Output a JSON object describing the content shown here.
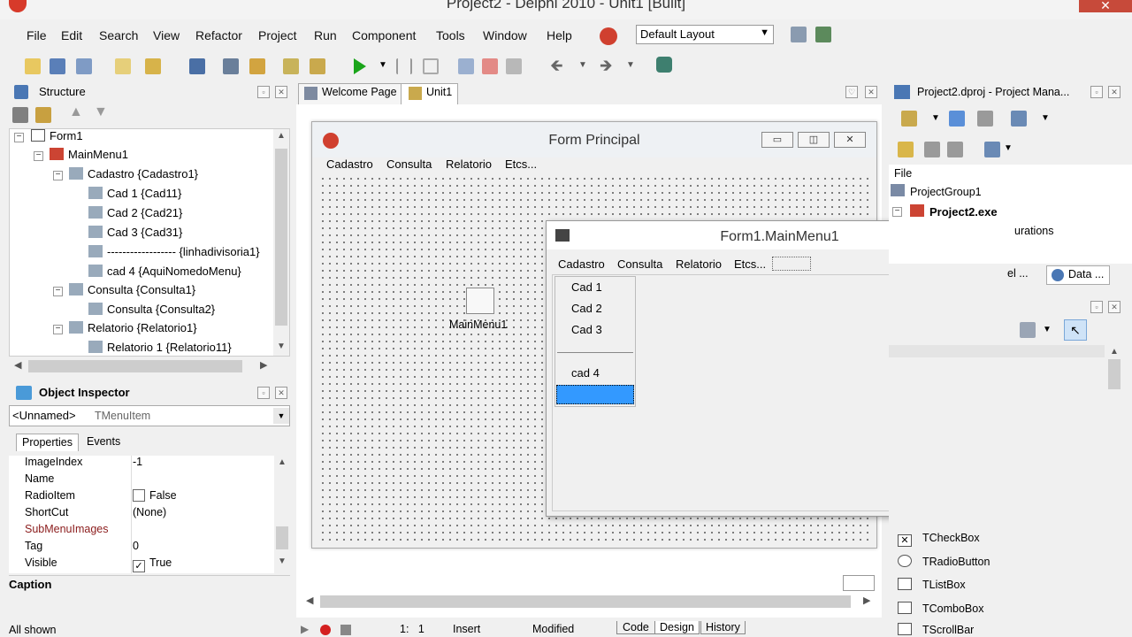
{
  "window": {
    "title": "Project2 - Delphi 2010 - Unit1 [Built]"
  },
  "menu": {
    "items": [
      "File",
      "Edit",
      "Search",
      "View",
      "Refactor",
      "Project",
      "Run",
      "Component",
      "Tools",
      "Window",
      "Help"
    ]
  },
  "layout_combo": {
    "value": "Default Layout"
  },
  "structure": {
    "title": "Structure",
    "nodes": [
      "Form1",
      "MainMenu1",
      "Cadastro {Cadastro1}",
      "Cad 1 {Cad11}",
      "Cad 2 {Cad21}",
      "Cad 3 {Cad31}",
      "------------------ {linhadivisoria1}",
      "cad 4 {AquiNomedoMenu}",
      "Consulta {Consulta1}",
      "Consulta {Consulta2}",
      "Relatorio {Relatorio1}",
      "Relatorio 1 {Relatorio11}"
    ]
  },
  "object_inspector": {
    "title": "Object Inspector",
    "selected_name": "<Unnamed>",
    "selected_type": "TMenuItem",
    "tabs": [
      "Properties",
      "Events"
    ],
    "rows": [
      {
        "key": "ImageIndex",
        "value": "-1"
      },
      {
        "key": "Name",
        "value": ""
      },
      {
        "key": "RadioItem",
        "value": "False"
      },
      {
        "key": "ShortCut",
        "value": "(None)"
      },
      {
        "key": "SubMenuImages",
        "value": ""
      },
      {
        "key": "Tag",
        "value": "0"
      },
      {
        "key": "Visible",
        "value": "True"
      }
    ],
    "footer_label": "Caption",
    "status": "All shown"
  },
  "editor_tabs": [
    "Welcome Page",
    "Unit1"
  ],
  "form_principal": {
    "title": "Form Principal",
    "menu": [
      "Cadastro",
      "Consulta",
      "Relatorio",
      "Etcs..."
    ],
    "component_label": "MainMenu1"
  },
  "menu_designer": {
    "title": "Form1.MainMenu1",
    "menu": [
      "Cadastro",
      "Consulta",
      "Relatorio",
      "Etcs..."
    ],
    "dropdown": [
      "Cad 1",
      "Cad 2",
      "Cad 3",
      "cad 4"
    ]
  },
  "project_manager": {
    "title": "Project2.dproj - Project Mana...",
    "column": "File",
    "group": "ProjectGroup1",
    "project": "Project2.exe",
    "partial": "urations",
    "tab_partial_left": "el ...",
    "tab_data": "Data ..."
  },
  "palette": [
    "TCheckBox",
    "TRadioButton",
    "TListBox",
    "TComboBox",
    "TScrollBar"
  ],
  "status": {
    "position": "1:   1",
    "mode": "Insert",
    "modified": "Modified",
    "tabs": [
      "Code",
      "Design",
      "History"
    ]
  },
  "colors": {
    "selection": "#3399ff",
    "close_red": "#c74a3a",
    "accent": "#2a6fc7"
  }
}
